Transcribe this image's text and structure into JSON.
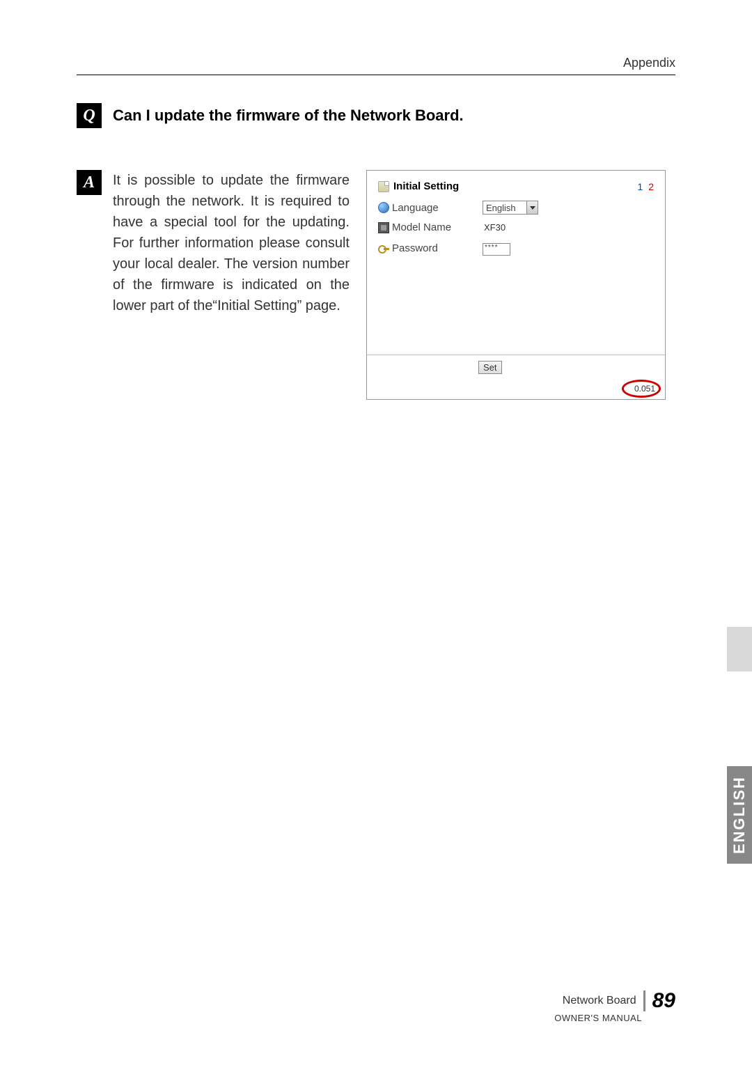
{
  "header": {
    "section": "Appendix"
  },
  "question": {
    "marker": "Q",
    "text": "Can I update the firmware of the Network Board."
  },
  "answer": {
    "marker": "A",
    "text": "It is possible to update the firmware through the network. It is required to have a special tool for the updating. For further information please consult your local dealer. The version number of the firmware is indicated on the lower part of the“Initial Setting” page."
  },
  "panel": {
    "title": "Initial Setting",
    "page1": "1",
    "page2": "2",
    "language_label": "Language",
    "language_value": "English",
    "model_label": "Model Name",
    "model_value": "XF30",
    "password_label": "Password",
    "password_value": "****",
    "set_button": "Set",
    "firmware_version": "0.051"
  },
  "side": {
    "language": "ENGLISH"
  },
  "footer": {
    "product": "Network Board",
    "page_number": "89",
    "manual": "OWNER'S MANUAL"
  }
}
